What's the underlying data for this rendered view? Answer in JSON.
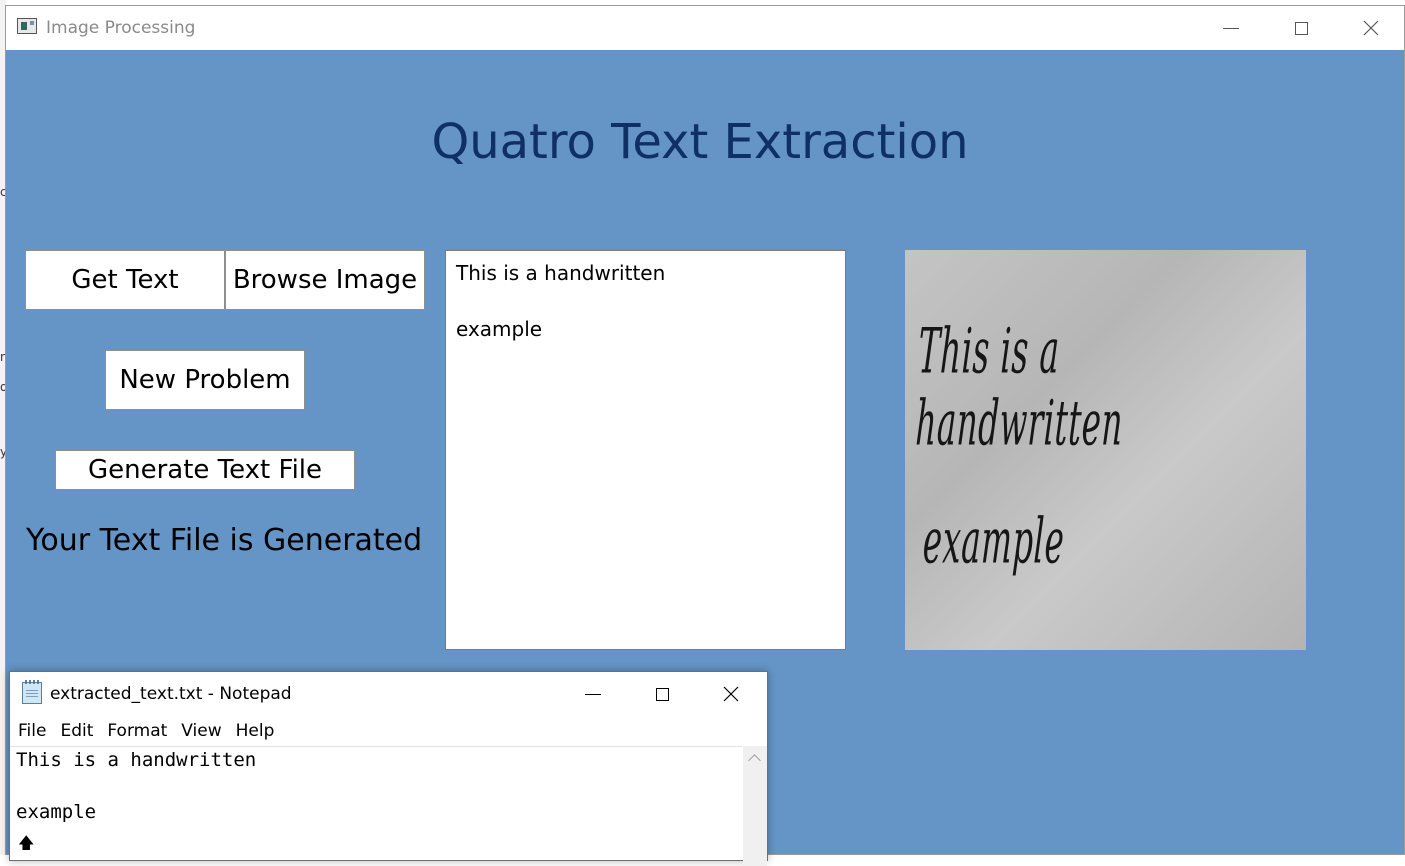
{
  "app": {
    "window_title": "Image Processing",
    "heading": "Quatro Text Extraction"
  },
  "buttons": {
    "get_text": "Get Text",
    "browse_image": "Browse Image",
    "new_problem": "New Problem",
    "generate_text_file": "Generate Text File"
  },
  "status_message": "Your Text File is Generated",
  "extracted_text": {
    "line1": "This is a handwritten",
    "line2": "",
    "line3": "example"
  },
  "image_preview": {
    "handwriting_line1": "This is a handwritten",
    "handwriting_line2": "example"
  },
  "notepad": {
    "title": "extracted_text.txt - Notepad",
    "menu": [
      "File",
      "Edit",
      "Format",
      "View",
      "Help"
    ],
    "content": {
      "line1": "This is a handwritten",
      "line2": "",
      "line3": "example"
    }
  },
  "background_window_fragments": [
    "c",
    "n",
    "o",
    "y"
  ]
}
